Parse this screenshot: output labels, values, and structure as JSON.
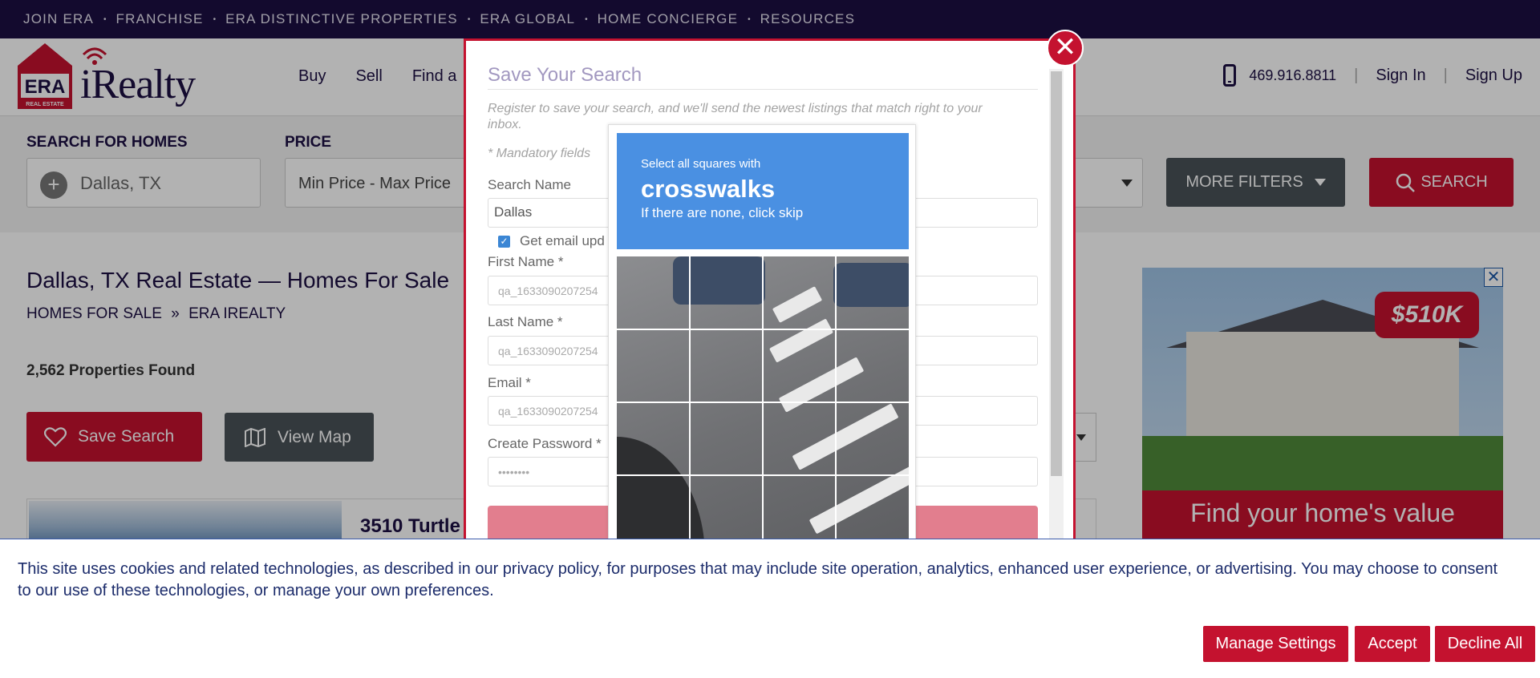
{
  "topbar": {
    "links": [
      "JOIN ERA",
      "FRANCHISE",
      "ERA DISTINCTIVE PROPERTIES",
      "ERA GLOBAL",
      "HOME CONCIERGE",
      "RESOURCES"
    ],
    "separator": "•"
  },
  "header": {
    "logo_era": "ERA",
    "logo_sub": "REAL ESTATE",
    "logo_brand": "iRealty",
    "nav": [
      "Buy",
      "Sell",
      "Find a"
    ],
    "phone": "469.916.8811",
    "sign_in": "Sign In",
    "sign_up": "Sign Up",
    "divider": "|"
  },
  "search": {
    "homes_label": "SEARCH FOR HOMES",
    "location_value": "Dallas, TX",
    "price_label": "PRICE",
    "price_value": "Min Price  -  Max Price",
    "more_filters": "MORE FILTERS",
    "search_button": "SEARCH"
  },
  "content": {
    "title": "Dallas, TX Real Estate — Homes For Sale",
    "breadcrumb": [
      "HOMES FOR SALE",
      "ERA IREALTY"
    ],
    "breadcrumb_sep": "»",
    "count": "2,562 Properties Found",
    "save_search": "Save Search",
    "view_map": "View Map",
    "listing_title": "3510 Turtle"
  },
  "ad": {
    "price_tag": "$510K",
    "headline": "Find your home's value",
    "close": "✕"
  },
  "modal": {
    "title": "Save Your Search",
    "subtitle": "Register to save your search, and we'll send the newest listings that match right to your inbox.",
    "mandatory": "* Mandatory fields",
    "search_name_label": "Search Name",
    "search_name_value": "Dallas",
    "email_updates_label": "Get email upd",
    "email_updates_checked": true,
    "first_name_label": "First Name *",
    "first_name_value": "qa_1633090207254",
    "last_name_label": "Last Name *",
    "last_name_value": "qa_1633090207254",
    "email_label": "Email *",
    "email_value": "qa_1633090207254",
    "password_label": "Create Password *",
    "password_value": "••••••••",
    "close": "✕"
  },
  "captcha": {
    "line1": "Select all squares with",
    "target": "crosswalks",
    "line3": "If there are none, click skip",
    "grid_rows": 4,
    "grid_cols": 4
  },
  "cookie": {
    "text": "This site uses cookies and related technologies, as described in our privacy policy, for purposes that may include site operation, analytics, enhanced user experience, or advertising. You may choose to consent to our use of these technologies, or manage your own preferences.",
    "manage": "Manage Settings",
    "accept": "Accept",
    "decline": "Decline All"
  },
  "colors": {
    "brand_navy": "#1c0f42",
    "brand_red": "#c4122f",
    "slate": "#4a5258",
    "captcha_blue": "#4a90e2"
  }
}
